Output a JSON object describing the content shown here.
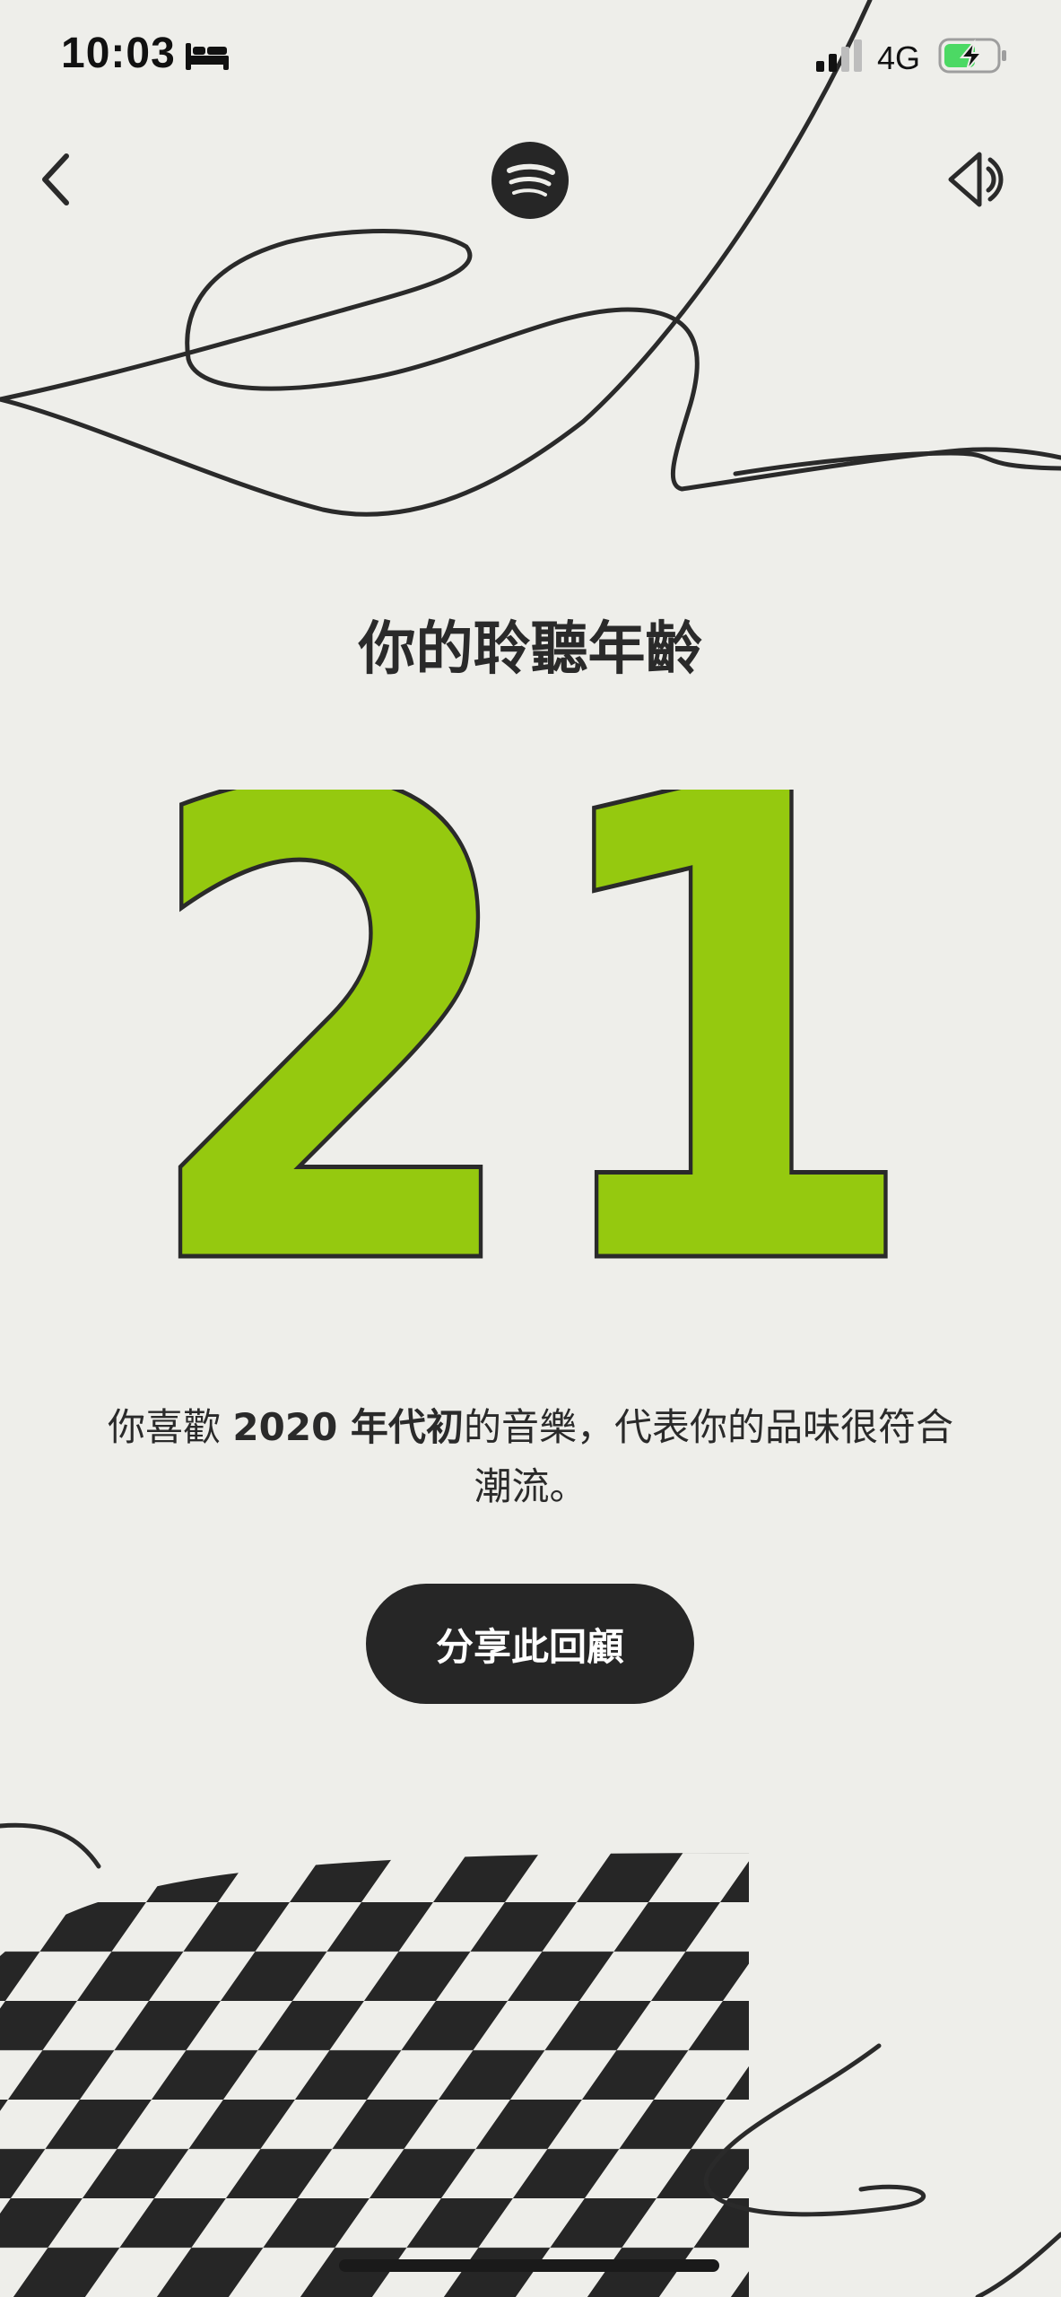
{
  "status_bar": {
    "time": "10:03",
    "network": "4G",
    "icons": [
      "bed-icon",
      "signal-icon",
      "battery-charging-icon"
    ]
  },
  "nav": {
    "back_icon": "chevron-left-icon",
    "logo_icon": "spotify-logo",
    "sound_icon": "speaker-icon"
  },
  "card": {
    "title": "你的聆聽年齡",
    "age_value": "21",
    "description_prefix": "你喜歡 ",
    "description_bold": "2020 年代初",
    "description_suffix": "的音樂，代表你的品味很符合潮流。",
    "share_label": "分享此回顧"
  },
  "colors": {
    "background": "#EEEEEA",
    "accent_green": "#95C90F",
    "ink": "#262626",
    "battery_green": "#4CD964"
  }
}
